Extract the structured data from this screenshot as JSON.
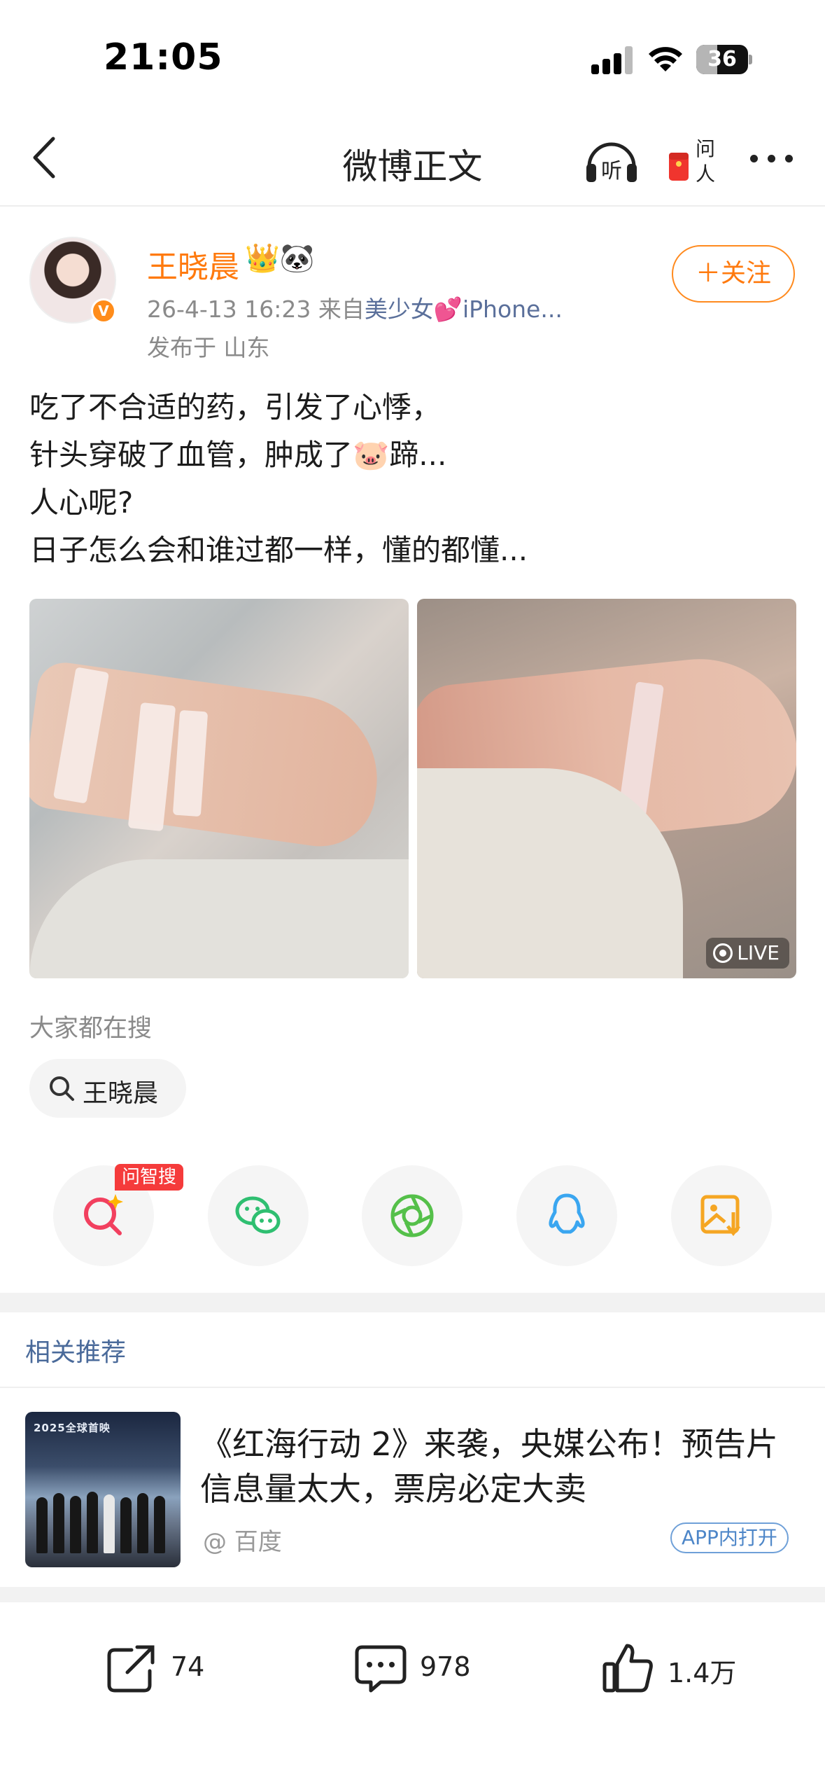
{
  "status_bar": {
    "time": "21:05",
    "battery": "36"
  },
  "nav": {
    "title": "微博正文",
    "listen_label": "听",
    "ask_label": "问人"
  },
  "author": {
    "name": "王晓晨",
    "name_emoji": "👑🐼",
    "verified_badge": "V",
    "meta_prefix": "26-4-13 16:23  来自",
    "meta_source": "美少女💕iPhone...",
    "location": "发布于 山东",
    "follow_label": "＋关注"
  },
  "post": {
    "lines": [
      "吃了不合适的药，引发了心悸，",
      "针头穿破了血管，肿成了🐷蹄...",
      "人心呢?",
      "日子怎么会和谁过都一样，懂的都懂..."
    ],
    "images": [
      {
        "name": "hand-with-iv-tape"
      },
      {
        "name": "swollen-wrist",
        "badge": "LIVE"
      }
    ]
  },
  "everyone_searching": {
    "heading": "大家都在搜",
    "chip": "王晓晨"
  },
  "share": {
    "ai_tag": "问智搜",
    "items": [
      {
        "icon": "ai-search-icon",
        "color": "#f2405f"
      },
      {
        "icon": "wechat-icon",
        "color": "#2fbf71"
      },
      {
        "icon": "moments-icon",
        "color": "#55c04a"
      },
      {
        "icon": "qq-icon",
        "color": "#3aa6f0"
      },
      {
        "icon": "save-image-icon",
        "color": "#f5a623"
      }
    ]
  },
  "related": {
    "heading": "相关推荐",
    "thumb_title": "2025全球首映",
    "title": "《红海行动 2》来袭，央媒公布！预告片信息量太大，票房必定大卖",
    "source": "@ 百度",
    "app_open": "APP内打开"
  },
  "bottom_bar": {
    "reposts": "74",
    "comments": "978",
    "likes": "1.4万"
  },
  "colors": {
    "accent_orange": "#ff7a0e",
    "link_blue": "#4a6a9a"
  }
}
